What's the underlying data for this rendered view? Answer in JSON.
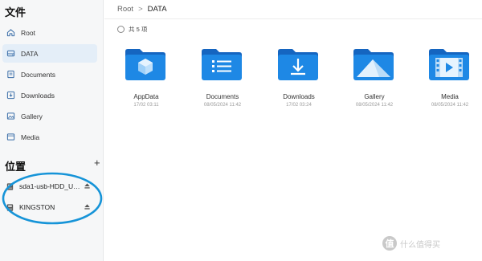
{
  "sidebar": {
    "files_title": "文件",
    "locations_title": "位置",
    "add_symbol": "+",
    "items": [
      {
        "label": "Root",
        "icon": "home-icon"
      },
      {
        "label": "DATA",
        "icon": "drive-icon"
      },
      {
        "label": "Documents",
        "icon": "document-icon"
      },
      {
        "label": "Downloads",
        "icon": "download-icon"
      },
      {
        "label": "Gallery",
        "icon": "image-icon"
      },
      {
        "label": "Media",
        "icon": "film-icon"
      }
    ],
    "drives": [
      {
        "label": "sda1-usb-HDD_USB...",
        "icon": "usb-drive-icon"
      },
      {
        "label": "KINGSTON",
        "icon": "usb-drive-icon"
      }
    ]
  },
  "breadcrumb": {
    "root": "Root",
    "separator": ">",
    "current": "DATA"
  },
  "select_all": {
    "label": "共 5 项"
  },
  "folders": [
    {
      "name": "AppData",
      "date": "17/02 03:11",
      "icon": "cube-folder-icon"
    },
    {
      "name": "Documents",
      "date": "08/05/2024 11:42",
      "icon": "document-folder-icon"
    },
    {
      "name": "Downloads",
      "date": "17/02 03:24",
      "icon": "download-folder-icon"
    },
    {
      "name": "Gallery",
      "date": "08/05/2024 11:42",
      "icon": "mountain-folder-icon"
    },
    {
      "name": "Media",
      "date": "08/05/2024 11:42",
      "icon": "film-folder-icon"
    }
  ],
  "watermark": {
    "glyph": "值",
    "text": "什么值得买"
  },
  "colors": {
    "accent": "#1a7fe0",
    "folder": "#1e88e5",
    "folder_tab": "#1565c0",
    "annotation": "#1694d8",
    "active_bg": "#e4eef8"
  }
}
